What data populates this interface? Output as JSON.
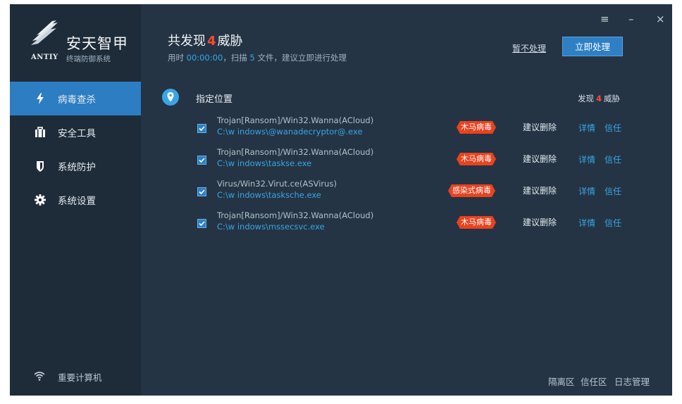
{
  "brand": {
    "name": "安天智甲",
    "en": "ANTIY",
    "sub": "终端防御系统"
  },
  "sidebar": {
    "items": [
      {
        "label": "病毒查杀",
        "icon": "lightning-icon",
        "active": true
      },
      {
        "label": "安全工具",
        "icon": "toolbox-icon",
        "active": false
      },
      {
        "label": "系统防护",
        "icon": "shield-icon",
        "active": false
      },
      {
        "label": "系统设置",
        "icon": "gear-icon",
        "active": false
      }
    ],
    "footer": {
      "label": "重要计算机",
      "icon": "wifi-icon"
    }
  },
  "header": {
    "title_prefix": "共发现",
    "title_count": "4",
    "title_suffix": "威胁",
    "sub_prefix": "用时",
    "sub_time": "00:00:00",
    "sub_mid": "，扫描",
    "sub_files": "5",
    "sub_suffix": "文件，建议立即进行处理",
    "ignore_label": "暂不处理",
    "action_label": "立即处理",
    "window_controls": [
      "≡",
      "–",
      "×"
    ]
  },
  "section": {
    "title": "指定位置",
    "count_prefix": "发现",
    "count": "4",
    "count_suffix": "威胁"
  },
  "threats": [
    {
      "name": "Trojan[Ransom]/Win32.Wanna(ACloud)",
      "path": "C:\\w indows\\@wanadecryptor@.exe",
      "tag": "木马病毒",
      "suggestion": "建议删除",
      "detail": "详情",
      "trust": "信任",
      "checked": true
    },
    {
      "name": "Trojan[Ransom]/Win32.Wanna(ACloud)",
      "path": "C:\\w indows\\taskse.exe",
      "tag": "木马病毒",
      "suggestion": "建议删除",
      "detail": "详情",
      "trust": "信任",
      "checked": true
    },
    {
      "name": "Virus/Win32.Virut.ce(ASVirus)",
      "path": "C:\\w indows\\tasksche.exe",
      "tag": "感染式病毒",
      "suggestion": "建议删除",
      "detail": "详情",
      "trust": "信任",
      "checked": true
    },
    {
      "name": "Trojan[Ransom]/Win32.Wanna(ACloud)",
      "path": "C:\\w indows\\mssecsvc.exe",
      "tag": "木马病毒",
      "suggestion": "建议删除",
      "detail": "详情",
      "trust": "信任",
      "checked": true
    }
  ],
  "footer": {
    "links": [
      "隔离区",
      "信任区",
      "日志管理"
    ]
  },
  "colors": {
    "accent": "#2d7dc2",
    "danger": "#e8431f",
    "link": "#3aa5e6",
    "bg": "#243444",
    "sidebar": "#1e2c39"
  }
}
